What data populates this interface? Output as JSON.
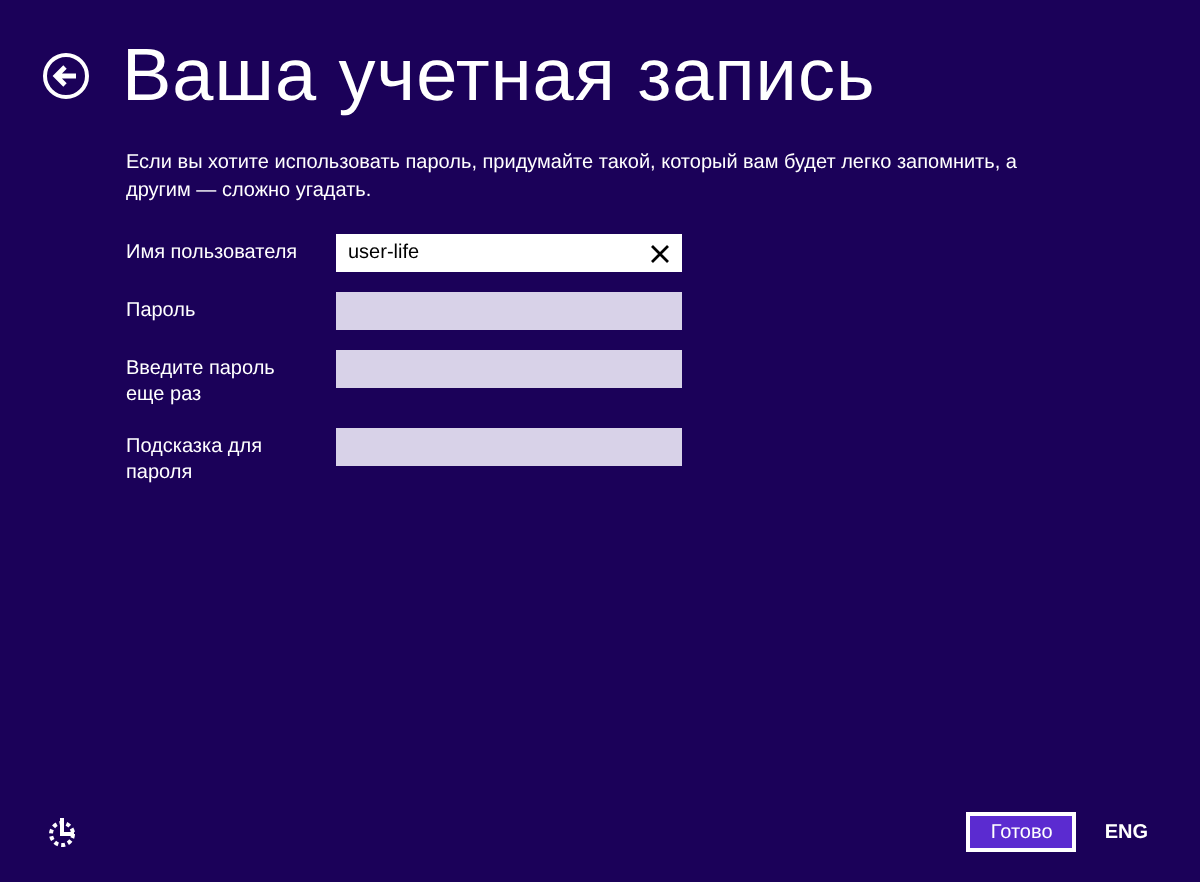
{
  "title": "Ваша учетная запись",
  "description": "Если вы хотите использовать пароль, придумайте такой, который вам будет легко запомнить, а другим — сложно угадать.",
  "fields": [
    {
      "label": "Имя пользователя",
      "value": "user-life"
    },
    {
      "label": "Пароль"
    },
    {
      "label": "Введите пароль еще раз"
    },
    {
      "label": "Подсказка для пароля"
    }
  ],
  "done_button": "Готово",
  "language": "ENG"
}
